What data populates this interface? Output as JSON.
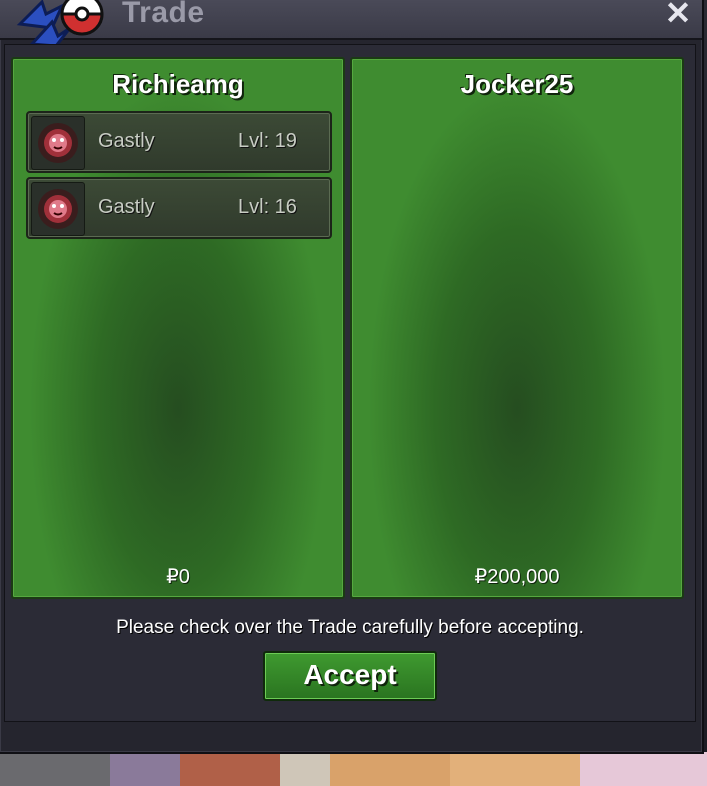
{
  "window": {
    "title": "Trade",
    "close_glyph": "✕",
    "logo_icon": "pokeball-icon"
  },
  "left_panel": {
    "player_name": "Richieamg",
    "money": "₽0",
    "pokemon": [
      {
        "name": "Gastly",
        "level": "Lvl: 19",
        "icon": "gastly-icon"
      },
      {
        "name": "Gastly",
        "level": "Lvl: 16",
        "icon": "gastly-icon"
      }
    ]
  },
  "right_panel": {
    "player_name": "Jocker25",
    "money": "₽200,000",
    "pokemon": []
  },
  "notice": "Please check over the Trade carefully before accepting.",
  "accept_label": "Accept",
  "colors": {
    "panel_green": "#2e6a24",
    "button_green": "#3f9a30",
    "window_bg": "#25252e"
  }
}
